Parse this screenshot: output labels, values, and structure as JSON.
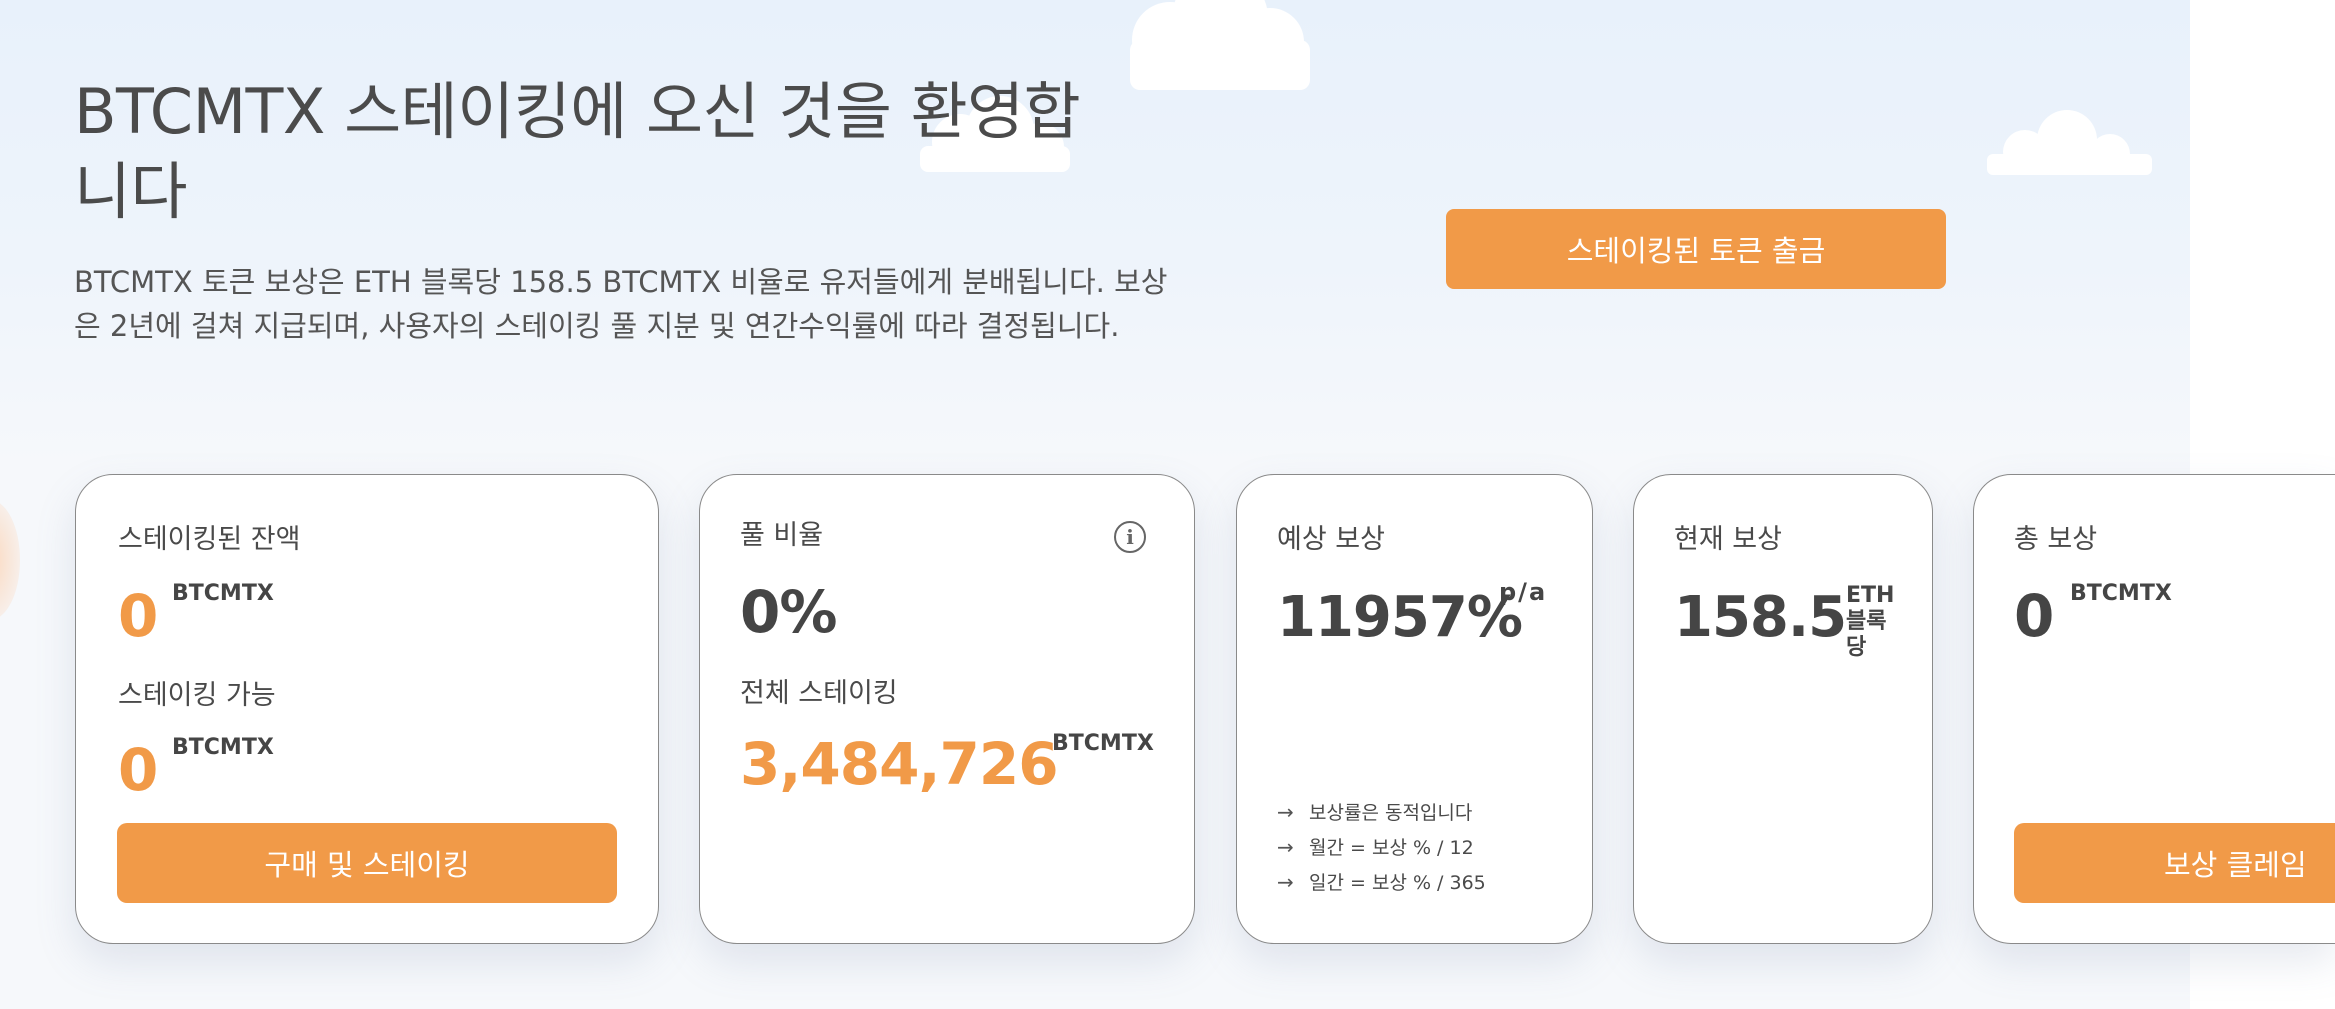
{
  "hero": {
    "title": "BTCMTX 스테이킹에 오신 것을 환영합니다",
    "description": "BTCMTX 토큰 보상은 ETH 블록당 158.5 BTCMTX 비율로 유저들에게 분배됩니다. 보상은 2년에 걸쳐 지급되며, 사용자의 스테이킹 풀 지분 및 연간수익률에 따라 결정됩니다.",
    "withdraw_button": "스테이킹된 토큰 출금"
  },
  "cards": {
    "balance": {
      "staked_label": "스테이킹된 잔액",
      "staked_value": "0",
      "staked_unit": "BTCMTX",
      "available_label": "스테이킹 가능",
      "available_value": "0",
      "available_unit": "BTCMTX",
      "button": "구매 및 스테이킹"
    },
    "pool": {
      "ratio_label": "풀 비율",
      "ratio_value": "0%",
      "info_icon": "i",
      "total_label": "전체 스테이킹",
      "total_value": "3,484,726",
      "total_unit": "BTCMTX"
    },
    "estimated": {
      "label": "예상 보상",
      "value": "11957%",
      "unit": "p/a",
      "arrow": "→",
      "notes": [
        "보상률은 동적입니다",
        "월간 = 보상 % / 12",
        "일간 = 보상 % / 365"
      ]
    },
    "current": {
      "label": "현재 보상",
      "value": "158.5",
      "unit_line1": "ETH",
      "unit_line2": "블록",
      "unit_line3": "당"
    },
    "total": {
      "label": "총 보상",
      "value": "0",
      "unit": "BTCMTX",
      "button": "보상 클레임"
    }
  },
  "colors": {
    "accent": "#f19a48",
    "text": "#4a4a4a",
    "card_border": "#8a8a8a"
  },
  "icons": {
    "info": "info-circle-icon",
    "arrow": "arrow-right-icon",
    "cloud": "cloud-icon"
  }
}
